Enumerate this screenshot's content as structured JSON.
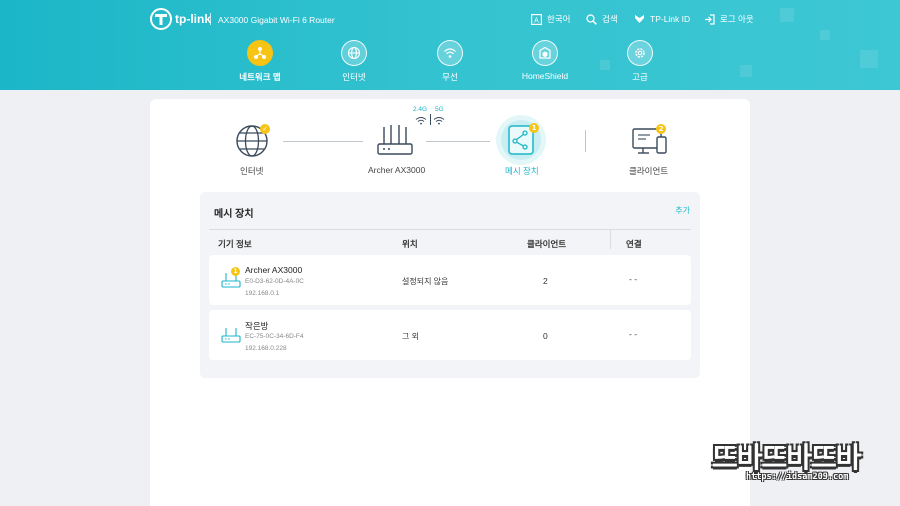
{
  "header": {
    "brand": "tp-link",
    "model": "AX3000 Gigabit Wi-Fi 6 Router",
    "utilities": [
      {
        "icon": "language-icon",
        "label": "한국어"
      },
      {
        "icon": "search-icon",
        "label": "검색"
      },
      {
        "icon": "tplink-id-icon",
        "label": "TP-Link ID"
      },
      {
        "icon": "logout-icon",
        "label": "로그 아웃"
      }
    ],
    "nav": [
      {
        "icon": "network-map-icon",
        "label": "네트워크 맵",
        "active": true
      },
      {
        "icon": "internet-globe-icon",
        "label": "인터넷",
        "active": false
      },
      {
        "icon": "wireless-icon",
        "label": "무선",
        "active": false
      },
      {
        "icon": "homeshield-icon",
        "label": "HomeShield",
        "active": false
      },
      {
        "icon": "advanced-gear-icon",
        "label": "고급",
        "active": false
      }
    ]
  },
  "topology": {
    "internet_label": "인터넷",
    "router_label": "Archer AX3000",
    "band_24": "2.4G",
    "band_5": "5G",
    "mesh_label": "메시 장치",
    "mesh_badge": "1",
    "clients_label": "클라이언트",
    "clients_badge": "2"
  },
  "mesh_panel": {
    "title": "메시 장치",
    "add_label": "추가",
    "columns": [
      "기기 정보",
      "위치",
      "클라이언트",
      "연결"
    ],
    "rows": [
      {
        "name": "Archer AX3000",
        "mac": "E0-D3-62-0D-4A-0C",
        "ip": "192.168.0.1",
        "location": "설정되지 않음",
        "clients": "2",
        "connection": "- -",
        "badge": "1"
      },
      {
        "name": "작은방",
        "mac": "EC-75-0C-34-6D-F4",
        "ip": "192.168.0.228",
        "location": "그 외",
        "clients": "0",
        "connection": "- -",
        "badge": ""
      }
    ]
  },
  "watermark": {
    "text": "뜨바뜨바뜨바",
    "url": "https://idsam209.com"
  },
  "colors": {
    "header_teal": "#1bb6c8",
    "accent_yellow": "#f7c414",
    "link_teal": "#1bb6c8"
  }
}
